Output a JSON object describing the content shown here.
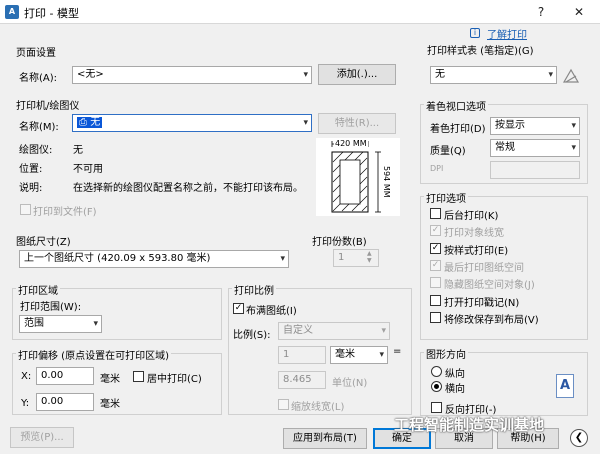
{
  "window": {
    "icon_text": "A",
    "title": "打印 - 模型",
    "help_glyph": "?",
    "close_glyph": "✕",
    "help_link": "了解打印",
    "info_glyph": "i"
  },
  "page_setup": {
    "group": "页面设置",
    "name_label": "名称(A):",
    "name_value": "<无>",
    "add_button": "添加(.)..."
  },
  "printer": {
    "group": "打印机/绘图仪",
    "name_label": "名称(M):",
    "name_value": "无",
    "properties_button": "特性(R)...",
    "plotter_label": "绘图仪:",
    "plotter_value": "无",
    "location_label": "位置:",
    "location_value": "不可用",
    "desc_label": "说明:",
    "desc_value": "在选择新的绘图仪配置名称之前，不能打印该布局。",
    "print_to_file": "打印到文件(F)",
    "preview_width": "420 MM",
    "preview_height": "594 MM"
  },
  "paper_size": {
    "group": "图纸尺寸(Z)",
    "value": "上一个图纸尺寸  (420.09 x 593.80 毫米)"
  },
  "copies": {
    "group": "打印份数(B)",
    "value": "1"
  },
  "plot_area": {
    "group": "打印区域",
    "what_label": "打印范围(W):",
    "what_value": "范围"
  },
  "plot_offset": {
    "group": "打印偏移 (原点设置在可打印区域)",
    "x_label": "X:",
    "x_value": "0.00",
    "x_unit": "毫米",
    "center": "居中打印(C)",
    "y_label": "Y:",
    "y_value": "0.00",
    "y_unit": "毫米"
  },
  "plot_scale": {
    "group": "打印比例",
    "fit_paper": "布满图纸(I)",
    "scale_label": "比例(S):",
    "scale_value": "自定义",
    "num_value": "1",
    "unit_value": "毫米",
    "equals": "=",
    "den_value": "8.465",
    "den_unit": "单位(N)",
    "scale_lineweights": "缩放线宽(L)"
  },
  "plot_style": {
    "group": "打印样式表 (笔指定)(G)",
    "value": "无"
  },
  "shaded": {
    "group": "着色视口选项",
    "shade_label": "着色打印(D)",
    "shade_value": "按显示",
    "quality_label": "质量(Q)",
    "quality_value": "常规",
    "dpi_label": "DPI"
  },
  "plot_options": {
    "group": "打印选项",
    "items": [
      {
        "label": "后台打印(K)",
        "checked": false,
        "enabled": true
      },
      {
        "label": "打印对象线宽",
        "checked": true,
        "enabled": false
      },
      {
        "label": "按样式打印(E)",
        "checked": true,
        "enabled": true
      },
      {
        "label": "最后打印图纸空间",
        "checked": true,
        "enabled": false
      },
      {
        "label": "隐藏图纸空间对象(J)",
        "checked": false,
        "enabled": false
      },
      {
        "label": "打开打印戳记(N)",
        "checked": false,
        "enabled": true
      },
      {
        "label": "将修改保存到布局(V)",
        "checked": false,
        "enabled": true
      }
    ]
  },
  "orientation": {
    "group": "图形方向",
    "portrait": "纵向",
    "landscape": "横向",
    "upside_down": "反向打印(-)",
    "icon_letter": "A"
  },
  "footer": {
    "preview_button": "预览(P)...",
    "apply_button": "应用到布局(T)",
    "ok_button": "确定",
    "cancel_button": "取消",
    "help_button": "帮助(H)",
    "collapse_glyph": "❮"
  },
  "watermark": "工程智能制造实训基地",
  "colors": {
    "accent": "#0078d7",
    "highlight": "#0a57d8",
    "help_link": "#1a5fb4"
  }
}
